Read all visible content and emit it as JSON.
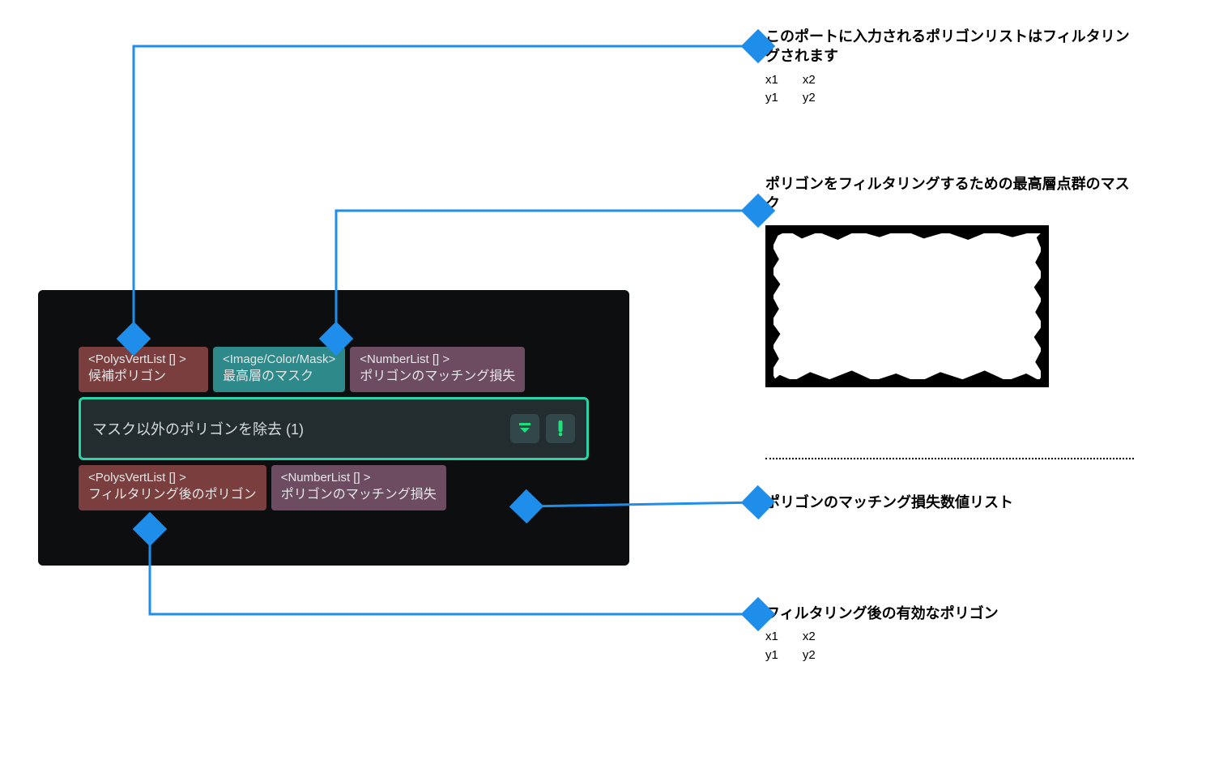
{
  "node": {
    "title": "マスク以外のポリゴンを除去 (1)",
    "inputs": [
      {
        "type": "<PolysVertList [] >",
        "label": "候補ポリゴン",
        "color": "red"
      },
      {
        "type": "<Image/Color/Mask>",
        "label": "最高層のマスク",
        "color": "teal"
      },
      {
        "type": "<NumberList [] >",
        "label": "ポリゴンのマッチング損失",
        "color": "purple"
      }
    ],
    "outputs": [
      {
        "type": "<PolysVertList [] >",
        "label": "フィルタリング後のポリゴン",
        "color": "red"
      },
      {
        "type": "<NumberList [] >",
        "label": "ポリゴンのマッチング損失",
        "color": "purple"
      }
    ]
  },
  "annotations": {
    "input_polys": {
      "title": "このポートに入力されるポリゴンリストはフィルタリングされます",
      "coords": {
        "c1": [
          "x1",
          "y1"
        ],
        "c2": [
          "x2",
          "y2"
        ]
      }
    },
    "mask": {
      "title": "ポリゴンをフィルタリングするための最高層点群のマスク"
    },
    "out_loss": {
      "title": "ポリゴンのマッチング損失数値リスト"
    },
    "out_polys": {
      "title": "フィルタリング後の有効なポリゴン",
      "coords": {
        "c1": [
          "x1",
          "y1"
        ],
        "c2": [
          "x2",
          "y2"
        ]
      }
    }
  }
}
